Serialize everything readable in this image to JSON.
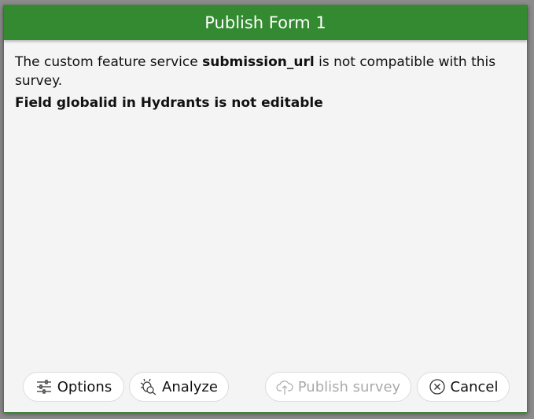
{
  "dialog": {
    "title": "Publish Form 1",
    "message_pre": "The custom feature service ",
    "message_bold": "submission_url",
    "message_post": " is not compatible with this survey.",
    "error": "Field globalid in Hydrants is not editable"
  },
  "buttons": {
    "options": {
      "label": "Options",
      "icon": "sliders-icon"
    },
    "analyze": {
      "label": "Analyze",
      "icon": "bug-search-icon"
    },
    "publish": {
      "label": "Publish survey",
      "icon": "cloud-upload-icon",
      "disabled": true
    },
    "cancel": {
      "label": "Cancel",
      "icon": "x-circle-icon"
    }
  },
  "colors": {
    "header": "#338a30",
    "body": "#f4f4f4"
  }
}
